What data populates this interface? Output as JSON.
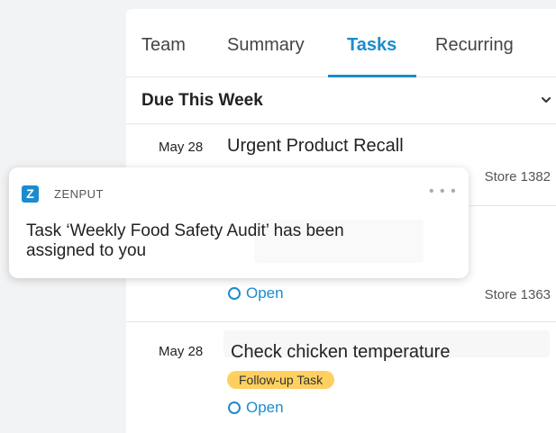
{
  "tabs": [
    {
      "label": "Team"
    },
    {
      "label": "Summary"
    },
    {
      "label": "Tasks"
    },
    {
      "label": "Recurring"
    }
  ],
  "active_tab": "Tasks",
  "section": {
    "title": "Due This Week",
    "chevron_icon": "chevron-down-icon"
  },
  "tasks": [
    {
      "date": "May 28",
      "title": "Urgent Product Recall",
      "store": "Store 1382"
    },
    {
      "date": "",
      "title": "",
      "status": "Open",
      "store": "Store 1363"
    },
    {
      "date": "May 28",
      "title": "Check chicken temperature",
      "badge": "Follow-up Task",
      "status": "Open"
    }
  ],
  "notification": {
    "app_name": "ZENPUT",
    "logo_letter": "Z",
    "more_icon": "more-horizontal-icon",
    "message": "Task ‘Weekly Food Safety Audit’ has been assigned to you"
  },
  "colors": {
    "accent": "#1a8ccd",
    "badge": "#ffd060",
    "background": "#f2f3f4"
  }
}
